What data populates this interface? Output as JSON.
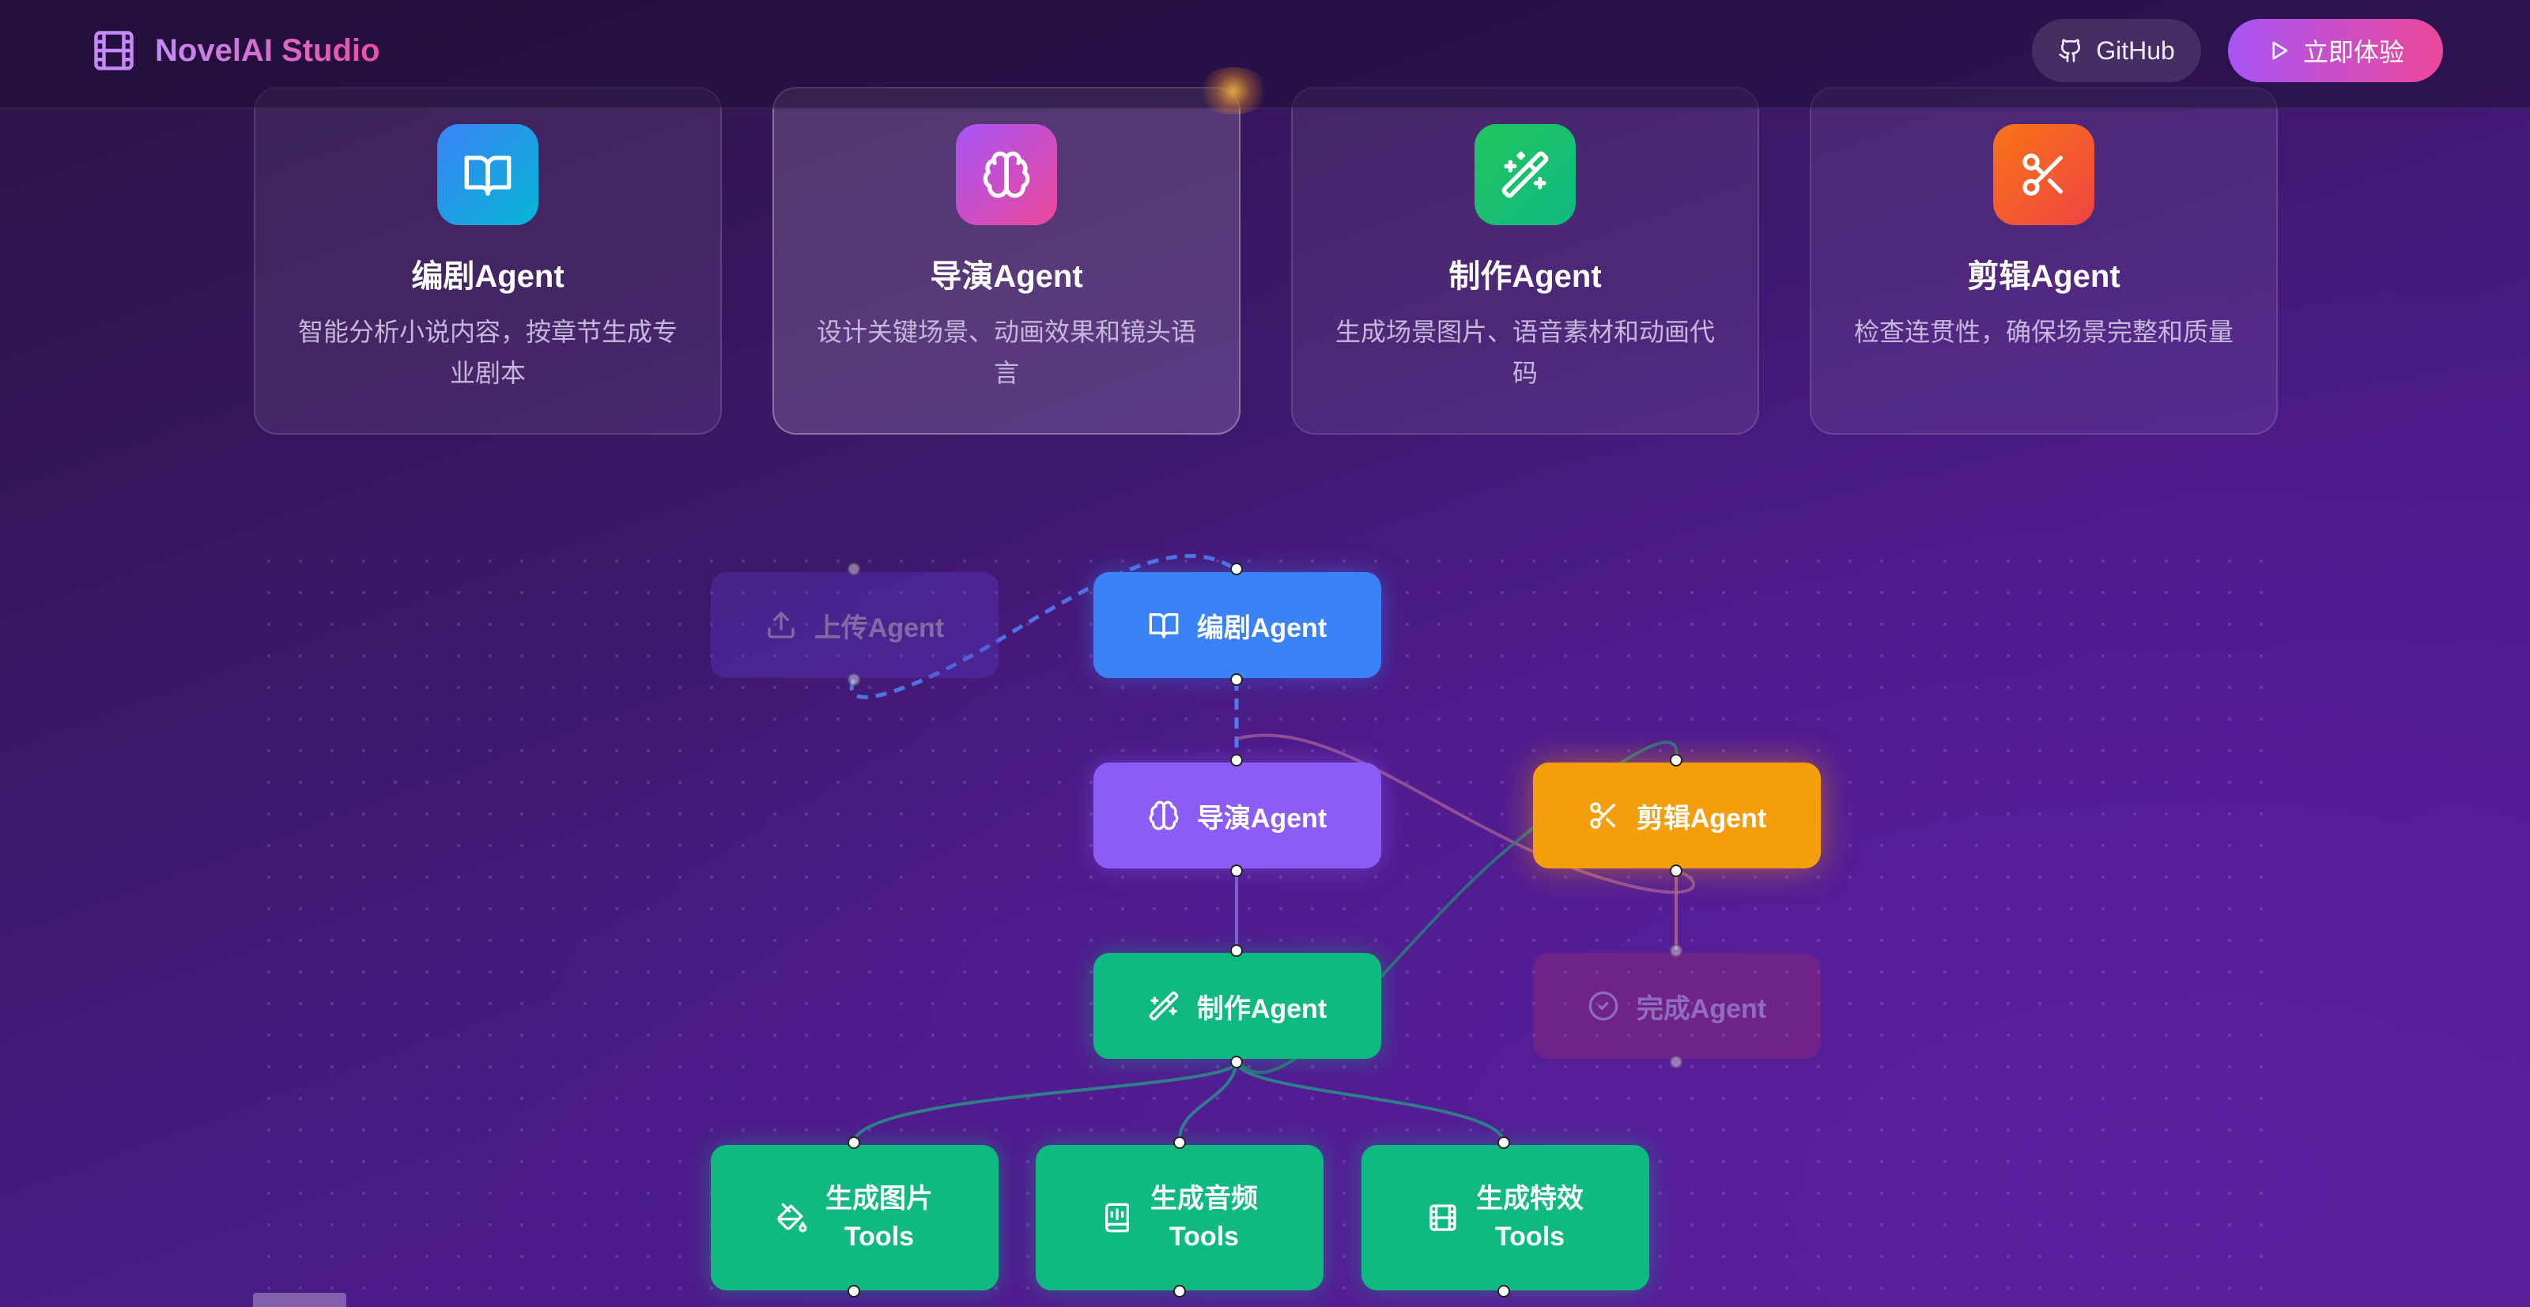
{
  "header": {
    "app_name": "NovelAI Studio",
    "github_label": "GitHub",
    "try_label": "立即体验"
  },
  "cards": [
    {
      "title": "编剧Agent",
      "desc": "智能分析小说内容，按章节生成专业剧本",
      "icon": "book-open-icon",
      "color": "#2f86f0"
    },
    {
      "title": "导演Agent",
      "desc": "设计关键场景、动画效果和镜头语言",
      "icon": "brain-icon",
      "color": "#c04ff0"
    },
    {
      "title": "制作Agent",
      "desc": "生成场景图片、语音素材和动画代码",
      "icon": "wand-sparkles-icon",
      "color": "#22c061"
    },
    {
      "title": "剪辑Agent",
      "desc": "检查连贯性，确保场景完整和质量",
      "icon": "scissors-icon",
      "color": "#f5621e"
    }
  ],
  "flow": {
    "nodes": {
      "upload": {
        "label": "上传Agent",
        "icon": "upload-icon",
        "state": "faded"
      },
      "script": {
        "label": "编剧Agent",
        "icon": "book-open-icon",
        "color": "#3b82f6"
      },
      "director": {
        "label": "导演Agent",
        "icon": "brain-icon",
        "color": "#8b5cf6"
      },
      "editor": {
        "label": "剪辑Agent",
        "icon": "scissors-icon",
        "color": "#f59e0b"
      },
      "production": {
        "label": "制作Agent",
        "icon": "wand-sparkles-icon",
        "color": "#10b981"
      },
      "done": {
        "label": "完成Agent",
        "icon": "check-circle-icon",
        "state": "faded"
      },
      "tool_image": {
        "line1": "生成图片",
        "line2": "Tools",
        "icon": "paint-bucket-icon",
        "color": "#10b981"
      },
      "tool_audio": {
        "line1": "生成音频",
        "line2": "Tools",
        "icon": "book-audio-icon",
        "color": "#10b981"
      },
      "tool_effect": {
        "line1": "生成特效",
        "line2": "Tools",
        "icon": "film-icon",
        "color": "#10b981"
      }
    }
  }
}
